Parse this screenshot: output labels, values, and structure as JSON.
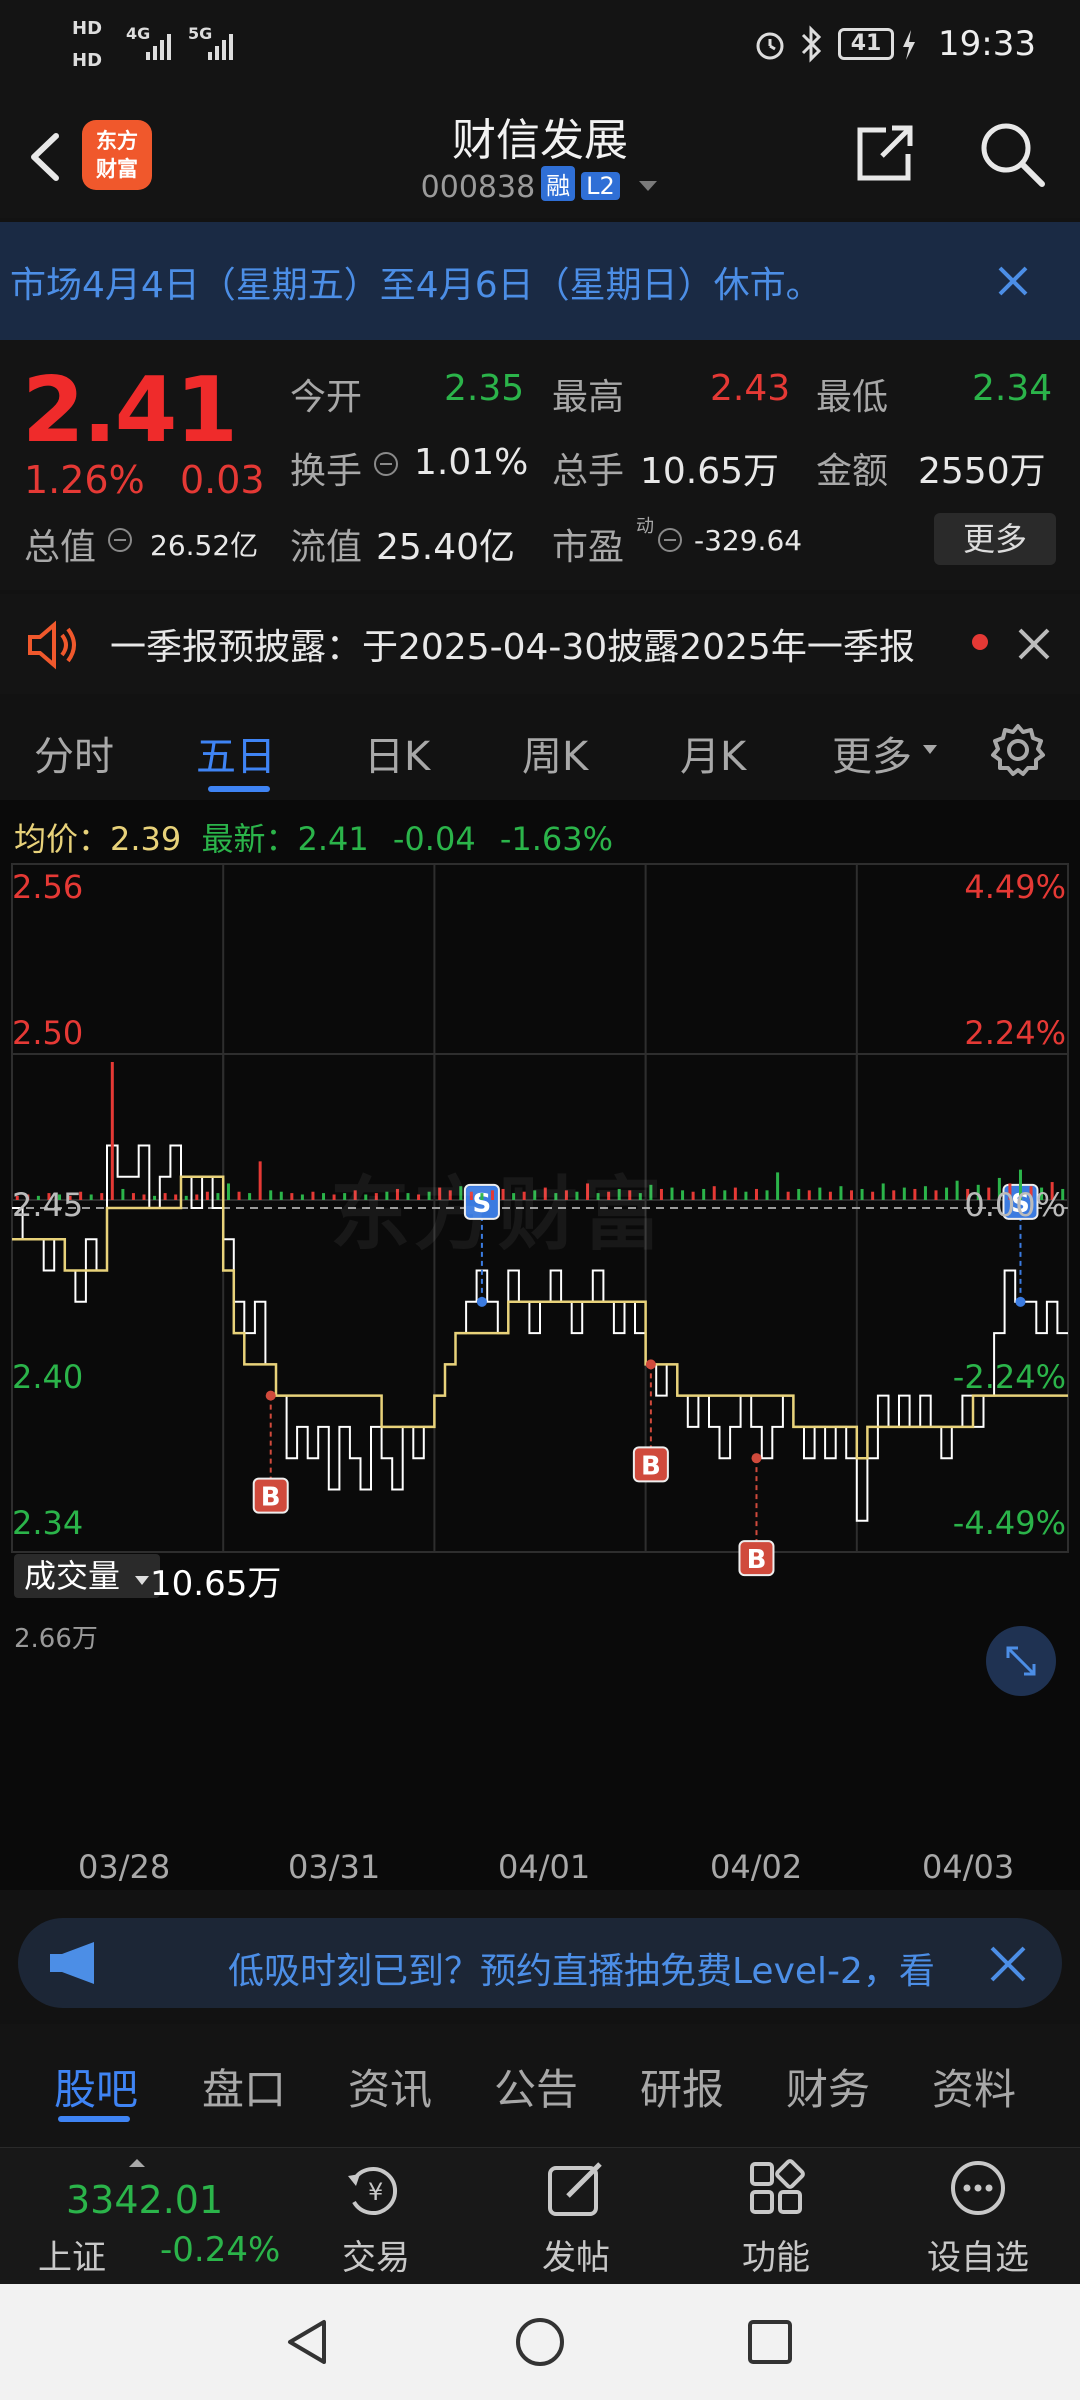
{
  "status_bar": {
    "hd1": "HD",
    "hd2": "HD",
    "net1": "4G",
    "net2": "5G",
    "battery": "41",
    "time": "19:33"
  },
  "header": {
    "logo_top": "东方",
    "logo_bottom": "财富",
    "stock_name": "财信发展",
    "stock_code": "000838",
    "tag_margin": "融",
    "tag_level": "L2"
  },
  "notice": {
    "text": "市场4月4日（星期五）至4月6日（星期日）休市。"
  },
  "quote": {
    "price": "2.41",
    "change_pct": "1.26%",
    "change_amt": "0.03",
    "open_label": "今开",
    "open": "2.35",
    "high_label": "最高",
    "high": "2.43",
    "low_label": "最低",
    "low": "2.34",
    "turnover_label": "换手",
    "turnover": "1.01%",
    "volume_label": "总手",
    "volume": "10.65万",
    "amount_label": "金额",
    "amount": "2550万",
    "mktcap_label": "总值",
    "mktcap": "26.52亿",
    "float_label": "流值",
    "float_cap": "25.40亿",
    "pe_label": "市盈",
    "pe_sup": "动",
    "pe": "-329.64",
    "more_label": "更多"
  },
  "announce": {
    "text": "一季报预披露：于2025-04-30披露2025年一季报"
  },
  "period_tabs": [
    "分时",
    "五日",
    "日K",
    "周K",
    "月K",
    "更多"
  ],
  "chart_legend": {
    "avg_label": "均价：",
    "avg": "2.39",
    "latest_label": "最新：",
    "latest": "2.41",
    "chg": "-0.04",
    "chg_pct": "-1.63%"
  },
  "watermark": "东方财富",
  "colors": {
    "up": "#e53935",
    "down": "#2bb44a",
    "accent": "#3f84f4",
    "avg_line": "#e8d27a",
    "price_line": "#ffffff"
  },
  "chart_data": {
    "type": "line",
    "title": "",
    "y_left_ticks": [
      "2.56",
      "2.50",
      "2.45",
      "2.40",
      "2.34"
    ],
    "y_right_ticks": [
      "4.49%",
      "2.24%",
      "0.00%",
      "-2.24%",
      "-4.49%"
    ],
    "ylim": [
      2.34,
      2.56
    ],
    "base_price": 2.45,
    "x_tick_labels": [
      "03/28",
      "03/31",
      "04/01",
      "04/02",
      "04/03"
    ],
    "series": [
      {
        "values": [
          2.45,
          2.44,
          2.44,
          2.43,
          2.44,
          2.43,
          2.42,
          2.44,
          2.43,
          2.47,
          2.46,
          2.46,
          2.47,
          2.45,
          2.46,
          2.47,
          2.46,
          2.45,
          2.46,
          2.45,
          2.44,
          2.42,
          2.41,
          2.42,
          2.4,
          2.39,
          2.37,
          2.38,
          2.37,
          2.38,
          2.36,
          2.38,
          2.37,
          2.36,
          2.38,
          2.37,
          2.36,
          2.38,
          2.37,
          2.38,
          2.39,
          2.4,
          2.41,
          2.42,
          2.43,
          2.42,
          2.41,
          2.43,
          2.42,
          2.41,
          2.42,
          2.43,
          2.42,
          2.41,
          2.42,
          2.43,
          2.42,
          2.41,
          2.42,
          2.41,
          2.4,
          2.39,
          2.4,
          2.39,
          2.38,
          2.39,
          2.38,
          2.37,
          2.38,
          2.39,
          2.38,
          2.37,
          2.38,
          2.39,
          2.38,
          2.37,
          2.38,
          2.37,
          2.38,
          2.37,
          2.35,
          2.37,
          2.39,
          2.38,
          2.39,
          2.38,
          2.39,
          2.38,
          2.37,
          2.38,
          2.39,
          2.38,
          2.39,
          2.41,
          2.43,
          2.42,
          2.42,
          2.41,
          2.42,
          2.41
        ]
      },
      {
        "values": [
          2.44,
          2.44,
          2.44,
          2.44,
          2.44,
          2.43,
          2.43,
          2.43,
          2.43,
          2.45,
          2.45,
          2.45,
          2.45,
          2.45,
          2.45,
          2.45,
          2.46,
          2.46,
          2.46,
          2.46,
          2.43,
          2.41,
          2.4,
          2.4,
          2.4,
          2.39,
          2.39,
          2.39,
          2.39,
          2.39,
          2.39,
          2.39,
          2.39,
          2.39,
          2.39,
          2.38,
          2.38,
          2.38,
          2.38,
          2.38,
          2.39,
          2.4,
          2.41,
          2.41,
          2.41,
          2.41,
          2.41,
          2.42,
          2.42,
          2.42,
          2.42,
          2.42,
          2.42,
          2.42,
          2.42,
          2.42,
          2.42,
          2.42,
          2.42,
          2.42,
          2.4,
          2.4,
          2.4,
          2.39,
          2.39,
          2.39,
          2.39,
          2.39,
          2.39,
          2.39,
          2.39,
          2.39,
          2.39,
          2.39,
          2.38,
          2.38,
          2.38,
          2.38,
          2.38,
          2.38,
          2.37,
          2.38,
          2.38,
          2.38,
          2.38,
          2.38,
          2.38,
          2.38,
          2.38,
          2.38,
          2.38,
          2.39,
          2.39,
          2.39,
          2.39,
          2.39,
          2.39,
          2.39,
          2.39,
          2.39
        ]
      }
    ],
    "trade_markers": [
      {
        "label": "B",
        "index": 24,
        "price": 2.39
      },
      {
        "label": "S",
        "index": 44,
        "price": 2.42
      },
      {
        "label": "B",
        "index": 60,
        "price": 2.4
      },
      {
        "label": "B",
        "index": 70,
        "price": 2.37
      },
      {
        "label": "S",
        "index": 95,
        "price": 2.42
      }
    ],
    "volume_title": "成交量",
    "volume_total": "10.65万",
    "volume_max_label": "2.66万",
    "volume": [
      3,
      4,
      3,
      5,
      4,
      3,
      6,
      4,
      5,
      100,
      8,
      5,
      4,
      3,
      5,
      4,
      3,
      4,
      6,
      5,
      12,
      6,
      5,
      28,
      7,
      6,
      5,
      4,
      6,
      5,
      4,
      5,
      7,
      4,
      5,
      6,
      8,
      5,
      4,
      6,
      9,
      7,
      10,
      6,
      5,
      7,
      8,
      5,
      6,
      7,
      9,
      5,
      7,
      6,
      12,
      5,
      6,
      8,
      7,
      5,
      11,
      8,
      9,
      7,
      6,
      8,
      10,
      7,
      9,
      6,
      8,
      7,
      20,
      6,
      8,
      7,
      9,
      6,
      10,
      7,
      8,
      6,
      12,
      7,
      9,
      8,
      10,
      7,
      9,
      14,
      8,
      11,
      9,
      16,
      12,
      22,
      10,
      9,
      13,
      8
    ],
    "volume_colors": [
      "r",
      "r",
      "g",
      "r",
      "g",
      "r",
      "r",
      "g",
      "r",
      "r",
      "g",
      "r",
      "r",
      "g",
      "r",
      "r",
      "g",
      "r",
      "r",
      "g",
      "g",
      "r",
      "g",
      "r",
      "g",
      "g",
      "r",
      "g",
      "r",
      "g",
      "r",
      "g",
      "r",
      "g",
      "r",
      "g",
      "r",
      "g",
      "r",
      "g",
      "r",
      "r",
      "g",
      "r",
      "g",
      "r",
      "r",
      "g",
      "r",
      "g",
      "r",
      "g",
      "r",
      "g",
      "r",
      "g",
      "r",
      "g",
      "r",
      "g",
      "g",
      "r",
      "g",
      "g",
      "r",
      "g",
      "r",
      "g",
      "r",
      "g",
      "r",
      "g",
      "g",
      "r",
      "g",
      "r",
      "g",
      "r",
      "g",
      "r",
      "g",
      "r",
      "g",
      "r",
      "g",
      "r",
      "g",
      "r",
      "g",
      "g",
      "r",
      "g",
      "r",
      "g",
      "r",
      "g",
      "r",
      "g",
      "r",
      "g"
    ]
  },
  "promo": {
    "text": "低吸时刻已到？预约直播抽免费Level-2，看"
  },
  "content_tabs": [
    "股吧",
    "盘口",
    "资讯",
    "公告",
    "研报",
    "财务",
    "资料"
  ],
  "bottom_nav": {
    "index_value": "3342.01",
    "index_name": "上证",
    "index_chg": "-0.24%",
    "items": [
      "交易",
      "发帖",
      "功能",
      "设自选"
    ]
  }
}
